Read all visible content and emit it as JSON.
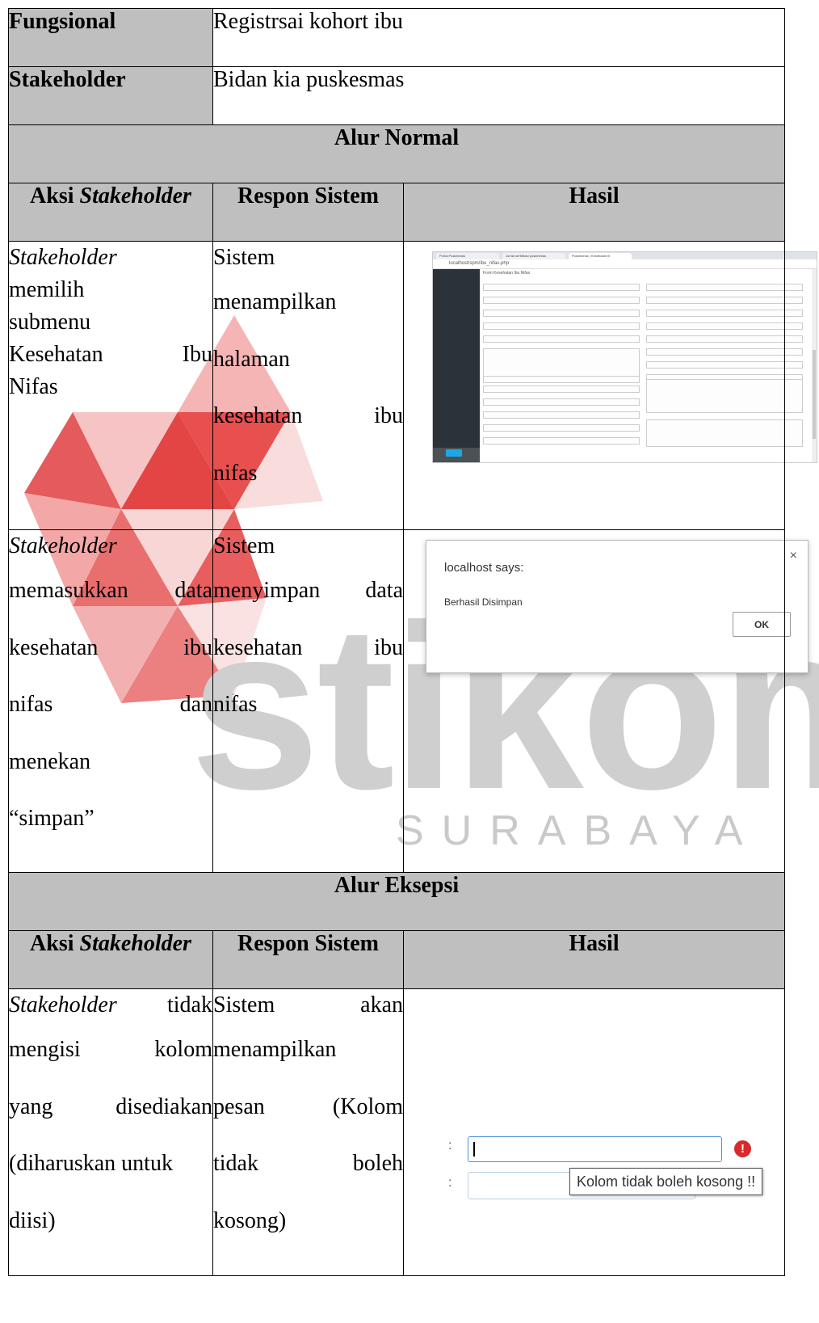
{
  "watermark": {
    "brand": "stikom",
    "city": "SURABAYA",
    "colors": {
      "logo_red": "#e34545",
      "logo_pink": "#f5b5b5",
      "text_grey": "#c9c9c9"
    }
  },
  "table": {
    "fungsional_label": "Fungsional",
    "fungsional_value": "Registrsai kohort ibu",
    "stakeholder_label": "Stakeholder",
    "stakeholder_value": "Bidan kia puskesmas",
    "normal_header": "Alur Normal",
    "exception_header": "Alur Eksepsi",
    "col_headers": {
      "aksi_prefix": "Aksi ",
      "aksi_italic": "Stakeholder",
      "respon": "Respon Sistem",
      "hasil": "Hasil"
    },
    "normal_rows": [
      {
        "aksi_lines": [
          {
            "italic": "Stakeholder",
            "text": ""
          },
          {
            "italic": "",
            "text": "memilih"
          },
          {
            "italic": "",
            "text": "submenu"
          },
          {
            "italic": "",
            "text": "Kesehatan Ibu"
          },
          {
            "italic": "",
            "text": "Nifas"
          }
        ],
        "respon_lines": [
          "Sistem",
          "menampilkan",
          "halaman",
          "kesehatan ibu",
          "nifas"
        ]
      },
      {
        "aksi_lines": [
          {
            "italic": "Stakeholder",
            "text": ""
          },
          {
            "italic": "",
            "text": "memasukkan data"
          },
          {
            "italic": "",
            "text": "kesehatan ibu"
          },
          {
            "italic": "",
            "text": "nifas dan"
          },
          {
            "italic": "",
            "text": "menekan"
          },
          {
            "italic": "",
            "text": "“simpan”"
          }
        ],
        "respon_lines": [
          "Sistem",
          "menyimpan data",
          "kesehatan ibu",
          "nifas"
        ]
      }
    ],
    "exception_rows": [
      {
        "aksi_lines": [
          {
            "italic": "Stakeholder",
            "text": " tidak"
          },
          {
            "italic": "",
            "text": "mengisi kolom"
          },
          {
            "italic": "",
            "text": "yang disediakan"
          },
          {
            "italic": "",
            "text": "(diharuskan untuk"
          },
          {
            "italic": "",
            "text": "diisi)"
          }
        ],
        "respon_lines": [
          "Sistem akan",
          "menampilkan",
          "pesan (Kolom",
          "tidak boleh",
          "kosong)"
        ]
      }
    ]
  },
  "shot1": {
    "url": "localhost/spm/ibu_nifas.php",
    "tabs": [
      "Portal Puskesmas",
      "Jurnal sertifikasi puskesmas",
      "Puskesmas | Kesehatan Ib"
    ],
    "form_title": "Form Kesehatan Ibu Nifas"
  },
  "shot2": {
    "title": "localhost says:",
    "message": "Berhasil Disimpan",
    "ok_label": "OK",
    "close_glyph": "×"
  },
  "shot3": {
    "colon": ":",
    "error_glyph": "!",
    "tooltip": "Kolom tidak boleh kosong !!"
  }
}
